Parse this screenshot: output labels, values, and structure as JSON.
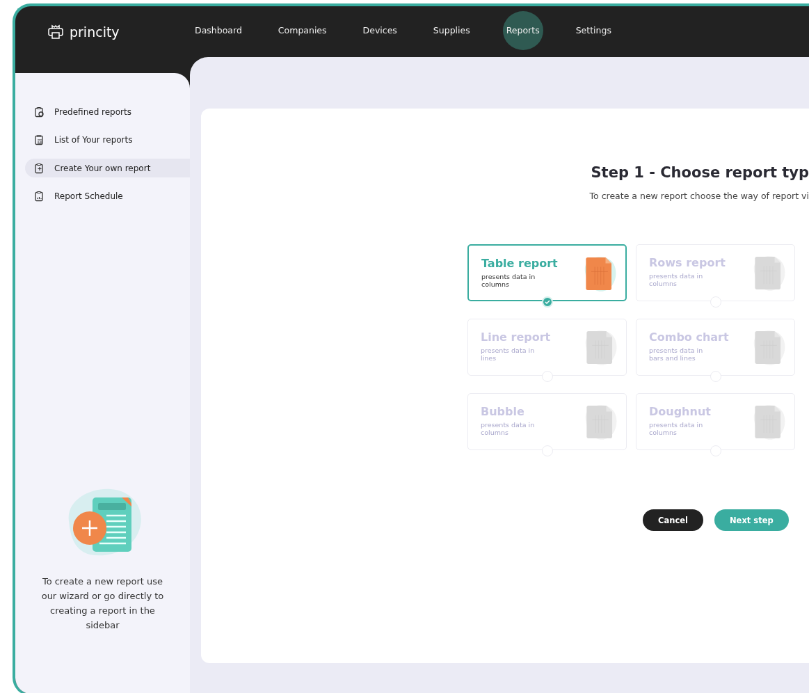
{
  "brand": {
    "name": "princity"
  },
  "nav": [
    {
      "label": "Dashboard",
      "selected": false
    },
    {
      "label": "Companies",
      "selected": false
    },
    {
      "label": "Devices",
      "selected": false
    },
    {
      "label": "Supplies",
      "selected": false
    },
    {
      "label": "Reports",
      "selected": true
    },
    {
      "label": "Settings",
      "selected": false
    }
  ],
  "sidebar": {
    "items": [
      {
        "label": "Predefined reports",
        "selected": false
      },
      {
        "label": "List of Your reports",
        "selected": false
      },
      {
        "label": "Create Your own report",
        "selected": true
      },
      {
        "label": "Report Schedule",
        "selected": false
      }
    ],
    "promo": {
      "text": "To create a new report use our wizard or go directly to creating a report in the sidebar"
    }
  },
  "wizard": {
    "title": "Step 1 - Choose report typ",
    "subtitle": "To create a new report choose the way of report vi",
    "report_types": [
      {
        "title": "Table report",
        "description": "presents data in columns",
        "selected": true
      },
      {
        "title": "Rows report",
        "description": "presents data in columns",
        "selected": false
      },
      {
        "title": "Line report",
        "description": "presents data in lines",
        "selected": false
      },
      {
        "title": "Combo chart",
        "description": "presents data in bars and lines",
        "selected": false
      },
      {
        "title": "Bubble",
        "description": "presents data in columns",
        "selected": false
      },
      {
        "title": "Doughnut",
        "description": "presents data in columns",
        "selected": false
      }
    ],
    "buttons": [
      {
        "label": "Cancel",
        "kind": "secondary"
      },
      {
        "label": "Next step",
        "kind": "primary"
      }
    ]
  }
}
